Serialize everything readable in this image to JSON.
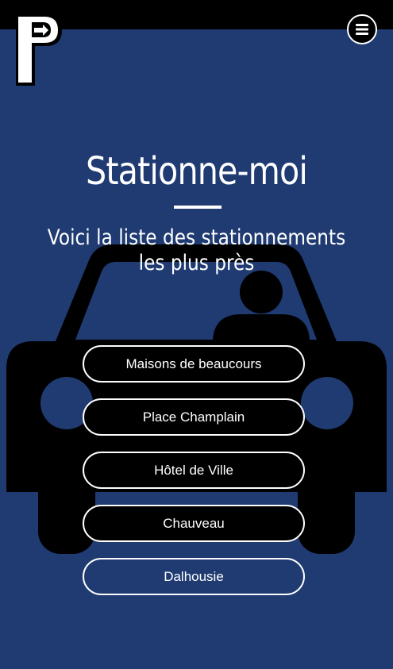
{
  "app": {
    "logo_icon": "parking-p-arrow-icon",
    "menu_icon": "hamburger-icon",
    "background_image": "car-with-driver-icon"
  },
  "hero": {
    "title": "Stationne-moi",
    "subtitle": "Voici la liste des stationnements les plus près"
  },
  "parkings": [
    {
      "label": "Maisons de beaucours"
    },
    {
      "label": "Place Champlain"
    },
    {
      "label": "Hôtel de Ville"
    },
    {
      "label": "Chauveau"
    },
    {
      "label": "Dalhousie"
    }
  ],
  "colors": {
    "background": "#1f3b72",
    "top_bar": "#000000",
    "button_fill": "#000000",
    "button_border": "#ffffff",
    "text": "#ffffff"
  }
}
